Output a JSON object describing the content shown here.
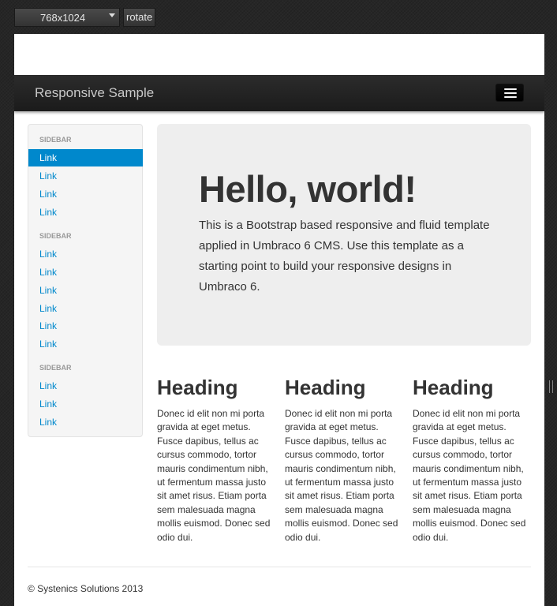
{
  "toolbar": {
    "device_value": "768x1024",
    "rotate_label": "rotate"
  },
  "navbar": {
    "brand": "Responsive Sample"
  },
  "sidebar": {
    "sections": [
      {
        "header": "SIDEBAR",
        "links": [
          "Link",
          "Link",
          "Link",
          "Link"
        ]
      },
      {
        "header": "SIDEBAR",
        "links": [
          "Link",
          "Link",
          "Link",
          "Link",
          "Link",
          "Link"
        ]
      },
      {
        "header": "SIDEBAR",
        "links": [
          "Link",
          "Link",
          "Link"
        ]
      }
    ]
  },
  "hero": {
    "title": "Hello, world!",
    "text": "This is a Bootstrap based responsive and fluid template applied in Umbraco 6 CMS. Use this template as a starting point to build your responsive designs in Umbraco 6."
  },
  "columns": [
    {
      "heading": "Heading",
      "body": "Donec id elit non mi porta gravida at eget metus. Fusce dapibus, tellus ac cursus commodo, tortor mauris condimentum nibh, ut fermentum massa justo sit amet risus. Etiam porta sem malesuada magna mollis euismod. Donec sed odio dui."
    },
    {
      "heading": "Heading",
      "body": "Donec id elit non mi porta gravida at eget metus. Fusce dapibus, tellus ac cursus commodo, tortor mauris condimentum nibh, ut fermentum massa justo sit amet risus. Etiam porta sem malesuada magna mollis euismod. Donec sed odio dui."
    },
    {
      "heading": "Heading",
      "body": "Donec id elit non mi porta gravida at eget metus. Fusce dapibus, tellus ac cursus commodo, tortor mauris condimentum nibh, ut fermentum massa justo sit amet risus. Etiam porta sem malesuada magna mollis euismod. Donec sed odio dui."
    }
  ],
  "footer": {
    "text": "© Systenics Solutions 2013"
  },
  "colors": {
    "link": "#0088cc",
    "active_bg": "#0088cc",
    "navbar": "#1b1b1b",
    "hero_bg": "#eeeeee"
  }
}
